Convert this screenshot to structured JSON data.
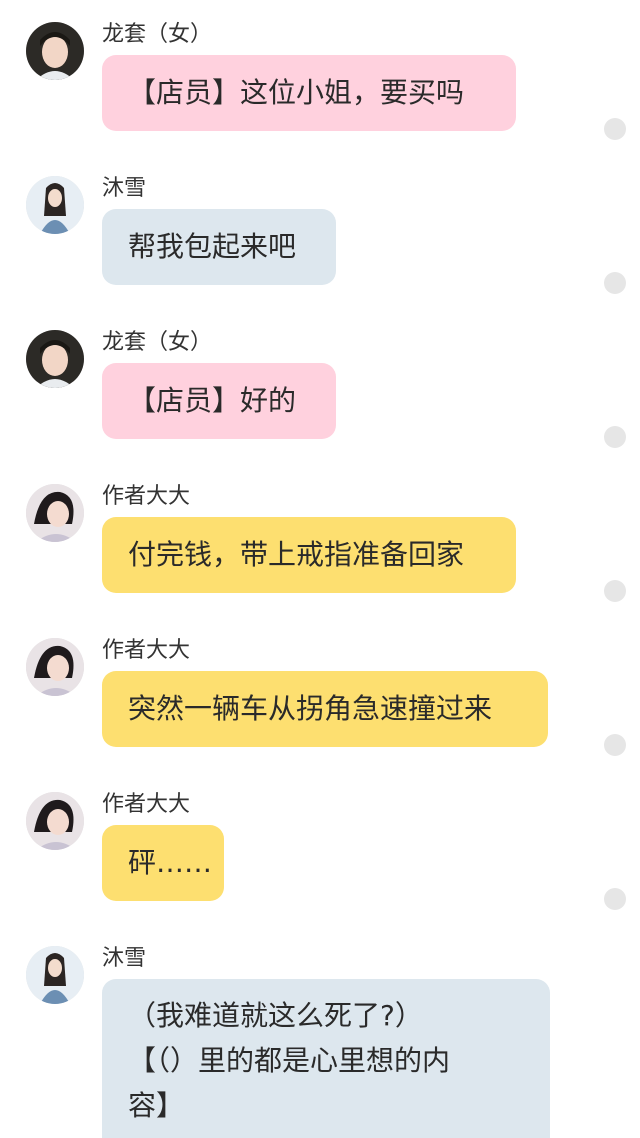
{
  "messages": [
    {
      "sender": "龙套（女）",
      "avatar": "female-extra-avatar",
      "role": "pink",
      "text": "【店员】这位小姐，要买吗"
    },
    {
      "sender": "沐雪",
      "avatar": "muxue-avatar",
      "role": "blue",
      "text": "帮我包起来吧"
    },
    {
      "sender": "龙套（女）",
      "avatar": "female-extra-avatar",
      "role": "pink",
      "text": "【店员】好的"
    },
    {
      "sender": "作者大大",
      "avatar": "author-avatar",
      "role": "yellow",
      "text": "付完钱，带上戒指准备回家"
    },
    {
      "sender": "作者大大",
      "avatar": "author-avatar",
      "role": "yellow",
      "text": "突然一辆车从拐角急速撞过来"
    },
    {
      "sender": "作者大大",
      "avatar": "author-avatar",
      "role": "yellow",
      "text": "砰……"
    },
    {
      "sender": "沐雪",
      "avatar": "muxue-avatar",
      "role": "blue",
      "lines": [
        "（我难道就这么死了?）",
        "【（）里的都是心里想的内",
        "容】"
      ]
    }
  ],
  "colors": {
    "pink": "#ffd1de",
    "blue": "#dde7ee",
    "yellow": "#fddf70",
    "dot": "#e6e6e6"
  }
}
